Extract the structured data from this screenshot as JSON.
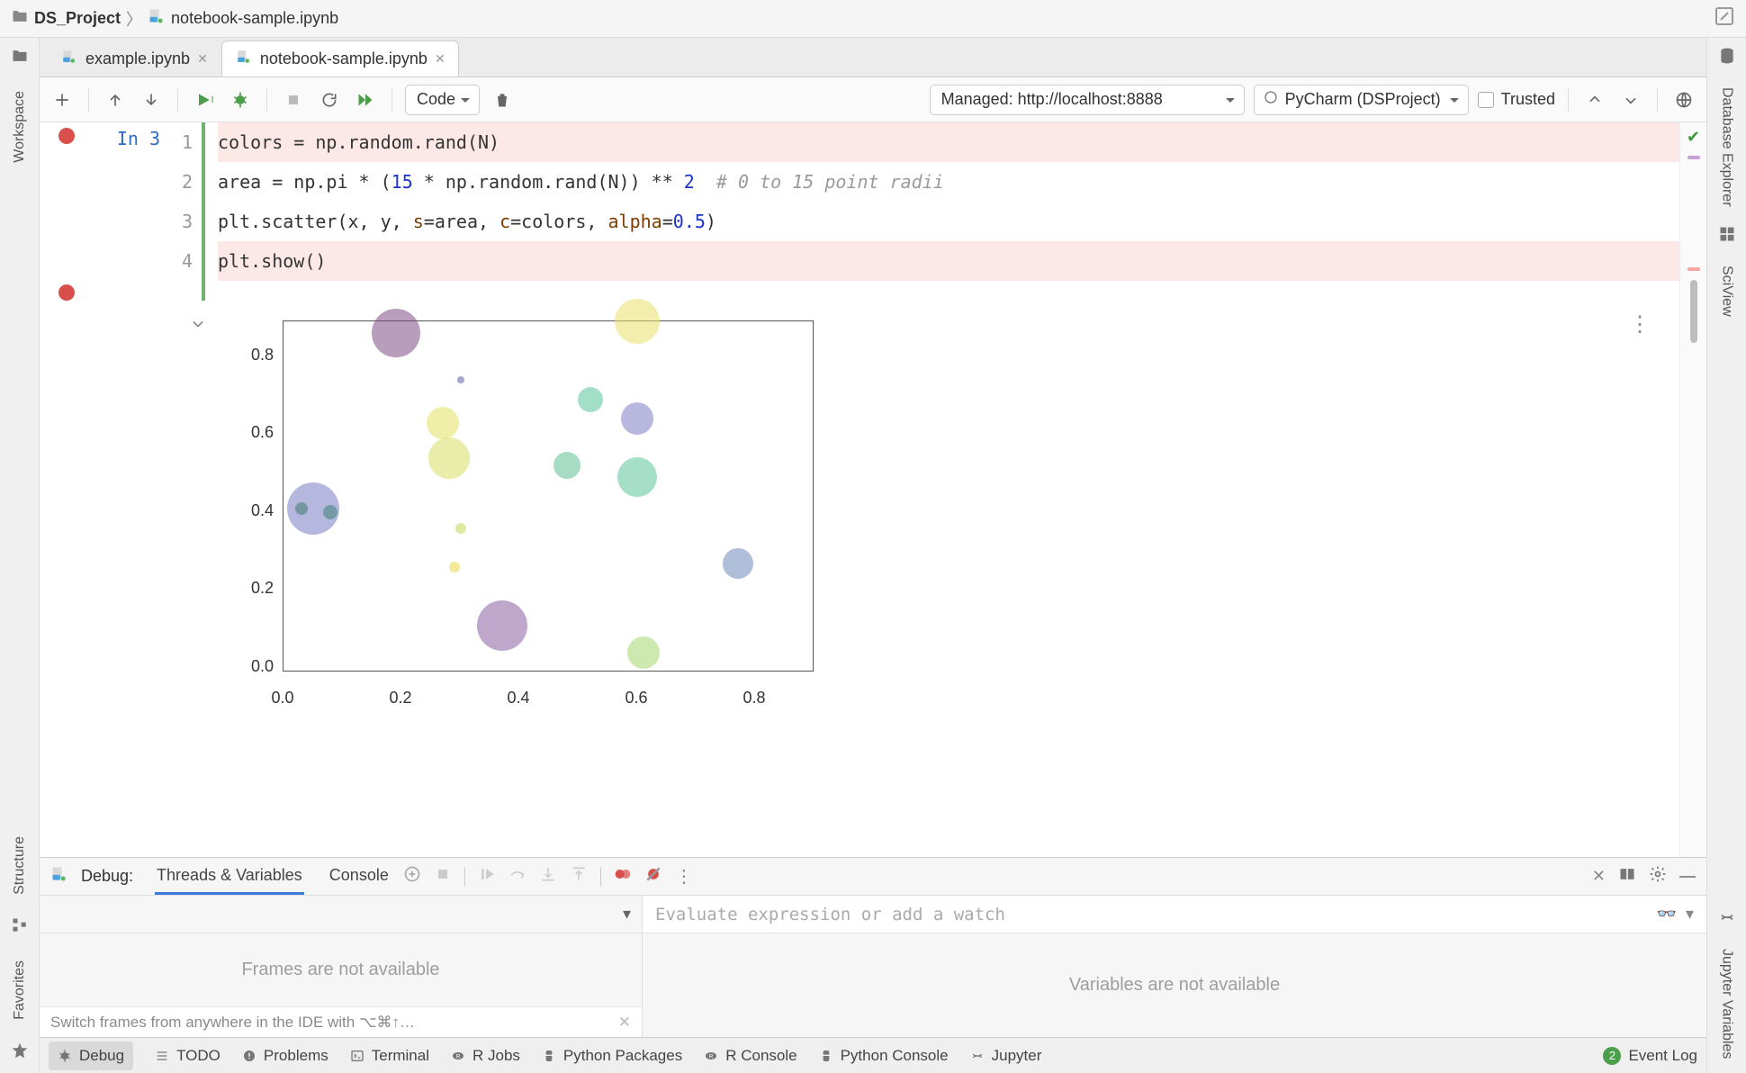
{
  "breadcrumb": {
    "project": "DS_Project",
    "file": "notebook-sample.ipynb"
  },
  "tabs": [
    {
      "label": "example.ipynb",
      "active": false
    },
    {
      "label": "notebook-sample.ipynb",
      "active": true
    }
  ],
  "left_gutter": {
    "workspace": "Workspace",
    "structure": "Structure",
    "favorites": "Favorites"
  },
  "right_gutter": {
    "dbexplorer": "Database Explorer",
    "sciview": "SciView",
    "jupvars": "Jupyter Variables"
  },
  "nb_toolbar": {
    "cell_type": "Code",
    "managed": "Managed: http://localhost:8888",
    "interpreter": "PyCharm (DSProject)",
    "trusted_label": "Trusted"
  },
  "cell": {
    "prompt": "In 3",
    "lines": {
      "l1_pre": "colors = np.random.rand(N)",
      "l2_a": "area = np.pi * (",
      "l2_n15": "15",
      "l2_b": " * np.random.rand(N)) ** ",
      "l2_n2": "2",
      "l2_comment": "  # 0 to 15 point radii",
      "l3_a": "plt.scatter(x, y, ",
      "l3_s": "s",
      "l3_b": "=area, ",
      "l3_c": "c",
      "l3_d": "=colors, ",
      "l3_alpha": "alpha",
      "l3_e": "=",
      "l3_n05": "0.5",
      "l3_f": ")",
      "l4": "plt.show()"
    },
    "line_numbers": {
      "n1": "1",
      "n2": "2",
      "n3": "3",
      "n4": "4"
    }
  },
  "chart_data": {
    "type": "scatter",
    "title": "",
    "xlabel": "",
    "ylabel": "",
    "xlim": [
      0.0,
      0.9
    ],
    "ylim": [
      0.0,
      0.9
    ],
    "xticks": [
      0.0,
      0.2,
      0.4,
      0.6,
      0.8
    ],
    "yticks": [
      0.0,
      0.2,
      0.4,
      0.6,
      0.8
    ],
    "xtick_labels": [
      "0.0",
      "0.2",
      "0.4",
      "0.6",
      "0.8"
    ],
    "ytick_labels": [
      "0.0",
      "0.2",
      "0.4",
      "0.6",
      "0.8"
    ],
    "points": [
      {
        "x": 0.19,
        "y": 0.87,
        "size": 54,
        "color": "#7d4d87"
      },
      {
        "x": 0.6,
        "y": 0.9,
        "size": 50,
        "color": "#e9e069"
      },
      {
        "x": 0.3,
        "y": 0.75,
        "size": 8,
        "color": "#5a5fa0"
      },
      {
        "x": 0.52,
        "y": 0.7,
        "size": 28,
        "color": "#58c49a"
      },
      {
        "x": 0.6,
        "y": 0.65,
        "size": 36,
        "color": "#7d7ec2"
      },
      {
        "x": 0.27,
        "y": 0.64,
        "size": 36,
        "color": "#e2e265"
      },
      {
        "x": 0.28,
        "y": 0.55,
        "size": 46,
        "color": "#d9dd62"
      },
      {
        "x": 0.48,
        "y": 0.53,
        "size": 30,
        "color": "#5fbf93"
      },
      {
        "x": 0.6,
        "y": 0.5,
        "size": 44,
        "color": "#5cc49b"
      },
      {
        "x": 0.05,
        "y": 0.42,
        "size": 58,
        "color": "#7a7cc4"
      },
      {
        "x": 0.03,
        "y": 0.42,
        "size": 14,
        "color": "#3d7b6b"
      },
      {
        "x": 0.08,
        "y": 0.41,
        "size": 16,
        "color": "#3e8574"
      },
      {
        "x": 0.3,
        "y": 0.37,
        "size": 12,
        "color": "#c9d958"
      },
      {
        "x": 0.29,
        "y": 0.27,
        "size": 12,
        "color": "#ecd94a"
      },
      {
        "x": 0.77,
        "y": 0.28,
        "size": 34,
        "color": "#6d8bb9"
      },
      {
        "x": 0.37,
        "y": 0.12,
        "size": 56,
        "color": "#8a5fa1"
      },
      {
        "x": 0.61,
        "y": 0.05,
        "size": 36,
        "color": "#a3d96e"
      }
    ]
  },
  "debug": {
    "title": "Debug:",
    "tabs": {
      "threads": "Threads & Variables",
      "console": "Console"
    },
    "frames_empty": "Frames are not available",
    "vars_empty": "Variables are not available",
    "eval_placeholder": "Evaluate expression or add a watch",
    "hint": "Switch frames from anywhere in the IDE with ⌥⌘↑…"
  },
  "statusbar": {
    "debug": "Debug",
    "todo": "TODO",
    "problems": "Problems",
    "terminal": "Terminal",
    "rjobs": "R Jobs",
    "pypkg": "Python Packages",
    "rconsole": "R Console",
    "pyconsole": "Python Console",
    "jupyter": "Jupyter",
    "eventlog": "Event Log",
    "event_badge": "2"
  }
}
